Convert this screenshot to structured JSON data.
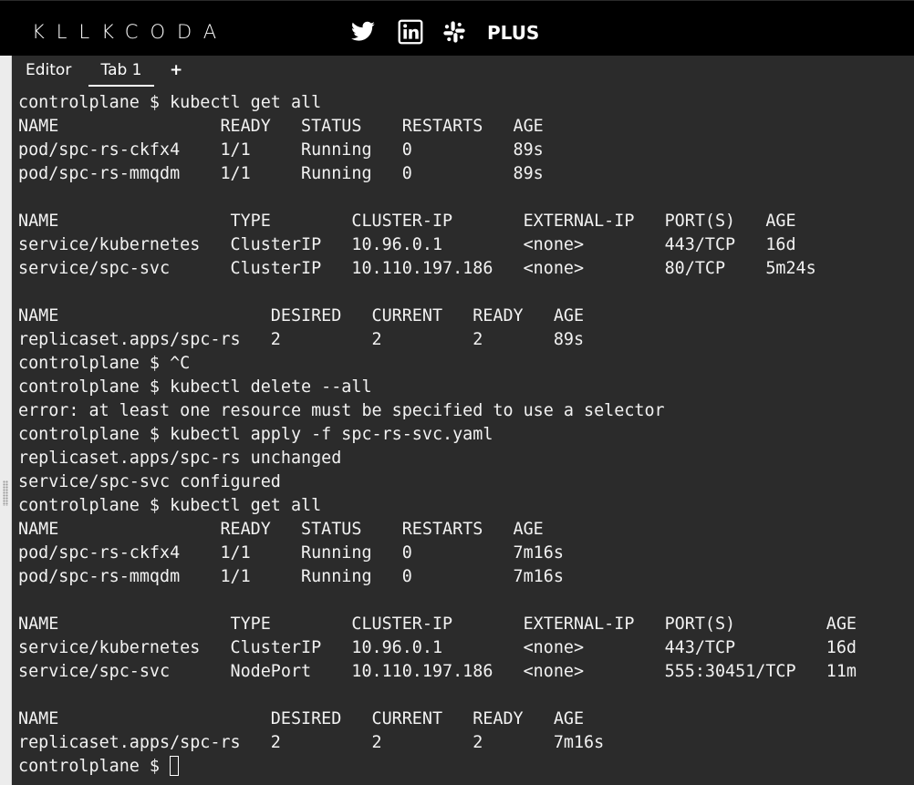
{
  "header": {
    "logo_text": "KLLKCODA",
    "plus_label": "PLUS",
    "social_icons": [
      "twitter-icon",
      "linkedin-icon",
      "slack-icon"
    ]
  },
  "tabs": [
    {
      "label": "Editor"
    },
    {
      "label": "Tab 1"
    },
    {
      "label": "+"
    }
  ],
  "terminal": {
    "prompt": "controlplane $ ",
    "lines": [
      "controlplane $ kubectl get all",
      "NAME                READY   STATUS    RESTARTS   AGE",
      "pod/spc-rs-ckfx4    1/1     Running   0          89s",
      "pod/spc-rs-mmqdm    1/1     Running   0          89s",
      "",
      "NAME                 TYPE        CLUSTER-IP       EXTERNAL-IP   PORT(S)   AGE",
      "service/kubernetes   ClusterIP   10.96.0.1        <none>        443/TCP   16d",
      "service/spc-svc      ClusterIP   10.110.197.186   <none>        80/TCP    5m24s",
      "",
      "NAME                     DESIRED   CURRENT   READY   AGE",
      "replicaset.apps/spc-rs   2         2         2       89s",
      "controlplane $ ^C",
      "controlplane $ kubectl delete --all",
      "error: at least one resource must be specified to use a selector",
      "controlplane $ kubectl apply -f spc-rs-svc.yaml",
      "replicaset.apps/spc-rs unchanged",
      "service/spc-svc configured",
      "controlplane $ kubectl get all",
      "NAME                READY   STATUS    RESTARTS   AGE",
      "pod/spc-rs-ckfx4    1/1     Running   0          7m16s",
      "pod/spc-rs-mmqdm    1/1     Running   0          7m16s",
      "",
      "NAME                 TYPE        CLUSTER-IP       EXTERNAL-IP   PORT(S)         AGE",
      "service/kubernetes   ClusterIP   10.96.0.1        <none>        443/TCP         16d",
      "service/spc-svc      NodePort    10.110.197.186   <none>        555:30451/TCP   11m",
      "",
      "NAME                     DESIRED   CURRENT   READY   AGE",
      "replicaset.apps/spc-rs   2         2         2       7m16s"
    ]
  },
  "colors": {
    "header_bg": "#000000",
    "terminal_bg": "#2b2b2b",
    "terminal_fg": "#f2f2f2"
  }
}
